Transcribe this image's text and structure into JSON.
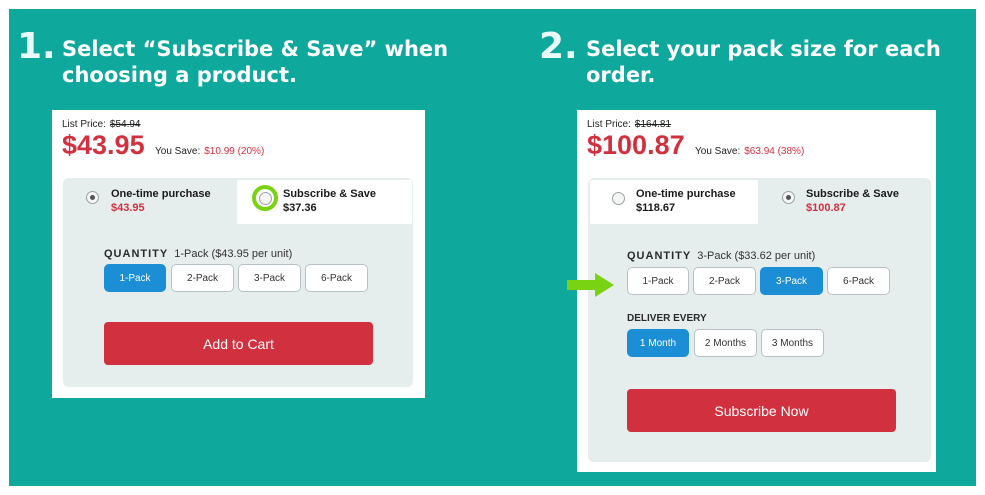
{
  "step1": {
    "number": "1.",
    "title_line1": "Select “Subscribe & Save” when",
    "title_line2": "choosing a product.",
    "list_price_label": "List Price:",
    "list_price": "$54.94",
    "price": "$43.95",
    "you_save_label": "You Save:",
    "you_save": "$10.99 (20%)",
    "one_time_label": "One-time purchase",
    "one_time_price": "$43.95",
    "subscribe_label": "Subscribe & Save",
    "subscribe_price": "$37.36",
    "quantity_label": "QUANTITY",
    "quantity_value": "1-Pack ($43.95 per unit)",
    "packs": [
      "1-Pack",
      "2-Pack",
      "3-Pack",
      "6-Pack"
    ],
    "selected_pack": "1-Pack",
    "cta": "Add to Cart"
  },
  "step2": {
    "number": "2.",
    "title_line1": "Select your pack size for each",
    "title_line2": "order.",
    "list_price_label": "List Price:",
    "list_price": "$164.81",
    "price": "$100.87",
    "you_save_label": "You Save:",
    "you_save": "$63.94 (38%)",
    "one_time_label": "One-time purchase",
    "one_time_price": "$118.67",
    "subscribe_label": "Subscribe & Save",
    "subscribe_price": "$100.87",
    "quantity_label": "QUANTITY",
    "quantity_value": "3-Pack ($33.62 per unit)",
    "packs": [
      "1-Pack",
      "2-Pack",
      "3-Pack",
      "6-Pack"
    ],
    "selected_pack": "3-Pack",
    "deliver_label": "DELIVER EVERY",
    "deliver_options": [
      "1 Month",
      "2 Months",
      "3 Months"
    ],
    "selected_deliver": "1 Month",
    "cta": "Subscribe Now"
  },
  "colors": {
    "background": "#0ea89c",
    "price_red": "#d1313f",
    "selected_blue": "#1b8ed6",
    "highlight_green": "#79d313",
    "panel_gray": "#e6eded"
  },
  "icons": {
    "highlight": "highlight-ring-icon",
    "pointer": "arrow-right-icon"
  }
}
